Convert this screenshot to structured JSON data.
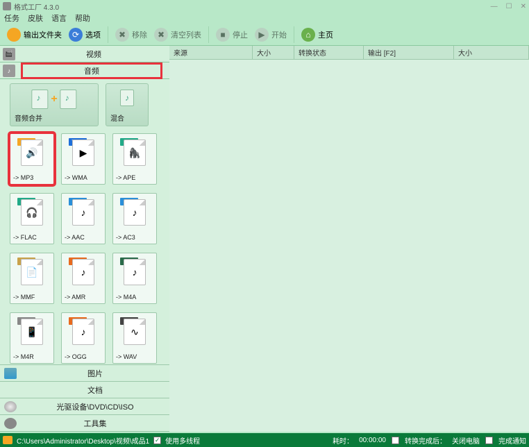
{
  "app": {
    "title": "格式工厂 4.3.0"
  },
  "menu": [
    "任务",
    "皮肤",
    "语言",
    "帮助"
  ],
  "toolbar": {
    "output_folder": "输出文件夹",
    "options": "选项",
    "remove": "移除",
    "clear_list": "清空列表",
    "stop": "停止",
    "start": "开始",
    "home": "主页"
  },
  "tabs": {
    "video": "视频",
    "audio": "音频"
  },
  "wide": {
    "merge": "音频合并",
    "mix": "混合"
  },
  "formats": [
    {
      "name": "MP3",
      "label": "-> MP3",
      "badge_bg": "#f5a623",
      "inner": "🔊",
      "hl": true
    },
    {
      "name": "WMA",
      "label": "-> WMA",
      "badge_bg": "#1e6fd9",
      "inner": "▶"
    },
    {
      "name": "APE",
      "label": "-> APE",
      "badge_bg": "#2a8",
      "inner": "🦍"
    },
    {
      "name": "FLA",
      "label": "-> FLAC",
      "badge_bg": "#2a8",
      "inner": "🎧"
    },
    {
      "name": "AAC",
      "label": "-> AAC",
      "badge_bg": "#2a8fd9",
      "inner": "♪"
    },
    {
      "name": "AAC",
      "label": "-> AC3",
      "badge_bg": "#2a8fd9",
      "inner": "♪"
    },
    {
      "name": "MMF",
      "label": "-> MMF",
      "badge_bg": "#c9a24a",
      "inner": "📄"
    },
    {
      "name": "AMR",
      "label": "-> AMR",
      "badge_bg": "#e86a1e",
      "inner": "♪"
    },
    {
      "name": "M4A",
      "label": "-> M4A",
      "badge_bg": "#2a6b4a",
      "inner": "♪"
    },
    {
      "name": "M4R",
      "label": "-> M4R",
      "badge_bg": "#888",
      "inner": "📱"
    },
    {
      "name": "OGG",
      "label": "-> OGG",
      "badge_bg": "#e86a1e",
      "inner": "♪"
    },
    {
      "name": "WAV",
      "label": "-> WAV",
      "badge_bg": "#444",
      "inner": "∿"
    }
  ],
  "nav": {
    "picture": "图片",
    "document": "文档",
    "disc": "光驱设备\\DVD\\CD\\ISO",
    "toolset": "工具集"
  },
  "columns": {
    "source": "来源",
    "size": "大小",
    "status": "转换状态",
    "output": "输出 [F2]",
    "size2": "大小"
  },
  "status": {
    "path": "C:\\Users\\Administrator\\Desktop\\视频\\成品1",
    "multithread": "使用多线程",
    "elapsed_label": "耗时：",
    "elapsed_value": "00:00:00",
    "after_label": "转换完成后：",
    "after_value": "关闭电脑",
    "notify": "完成通知"
  }
}
